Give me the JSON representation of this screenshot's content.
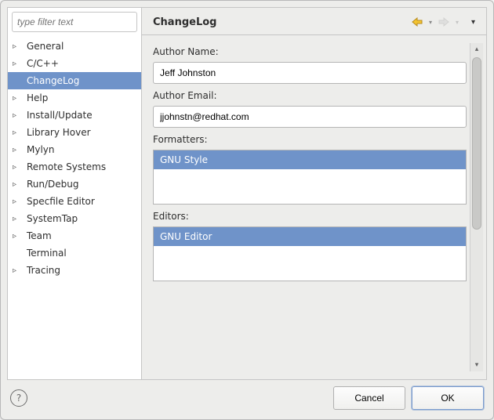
{
  "filter": {
    "placeholder": "type filter text"
  },
  "tree": {
    "items": [
      {
        "label": "General",
        "expandable": true,
        "selected": false
      },
      {
        "label": "C/C++",
        "expandable": true,
        "selected": false
      },
      {
        "label": "ChangeLog",
        "expandable": false,
        "selected": true
      },
      {
        "label": "Help",
        "expandable": true,
        "selected": false
      },
      {
        "label": "Install/Update",
        "expandable": true,
        "selected": false
      },
      {
        "label": "Library Hover",
        "expandable": true,
        "selected": false
      },
      {
        "label": "Mylyn",
        "expandable": true,
        "selected": false
      },
      {
        "label": "Remote Systems",
        "expandable": true,
        "selected": false
      },
      {
        "label": "Run/Debug",
        "expandable": true,
        "selected": false
      },
      {
        "label": "Specfile Editor",
        "expandable": true,
        "selected": false
      },
      {
        "label": "SystemTap",
        "expandable": true,
        "selected": false
      },
      {
        "label": "Team",
        "expandable": true,
        "selected": false
      },
      {
        "label": "Terminal",
        "expandable": false,
        "selected": false
      },
      {
        "label": "Tracing",
        "expandable": true,
        "selected": false
      }
    ]
  },
  "page": {
    "title": "ChangeLog",
    "author_name_label": "Author Name:",
    "author_name_value": "Jeff Johnston",
    "author_email_label": "Author Email:",
    "author_email_value": "jjohnstn@redhat.com",
    "formatters_label": "Formatters:",
    "formatters": [
      {
        "label": "GNU Style",
        "selected": true
      }
    ],
    "editors_label": "Editors:",
    "editors": [
      {
        "label": "GNU Editor",
        "selected": true
      }
    ]
  },
  "buttons": {
    "cancel": "Cancel",
    "ok": "OK"
  },
  "help": {
    "glyph": "?"
  }
}
